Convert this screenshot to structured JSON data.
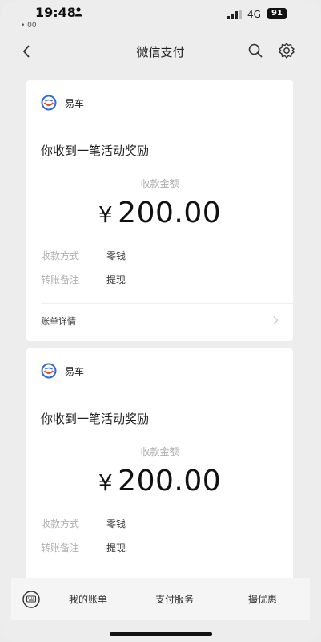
{
  "status_bar": {
    "time": "19:48",
    "sub": "• 00",
    "network": "4G",
    "battery": "91"
  },
  "nav": {
    "title": "微信支付"
  },
  "cards": [
    {
      "merchant": "易车",
      "title": "你收到一笔活动奖励",
      "amount_label": "收款金额",
      "currency": "¥",
      "amount": "200.00",
      "method_key": "收款方式",
      "method_value": "零钱",
      "note_key": "转账备注",
      "note_value": "提现",
      "bill_link": "账单详情"
    },
    {
      "merchant": "易车",
      "title": "你收到一笔活动奖励",
      "amount_label": "收款金额",
      "currency": "¥",
      "amount": "200.00",
      "method_key": "收款方式",
      "method_value": "零钱",
      "note_key": "转账备注",
      "note_value": "提现"
    }
  ],
  "bottom_bar": {
    "items": [
      "我的账单",
      "支付服务",
      "撮优惠"
    ]
  },
  "colors": {
    "accent_blue": "#2b6cd6",
    "accent_red": "#e0463a"
  },
  "icons": {
    "back": "chevron-left-icon",
    "search": "search-icon",
    "settings": "gear-icon",
    "keyboard": "keyboard-icon"
  }
}
